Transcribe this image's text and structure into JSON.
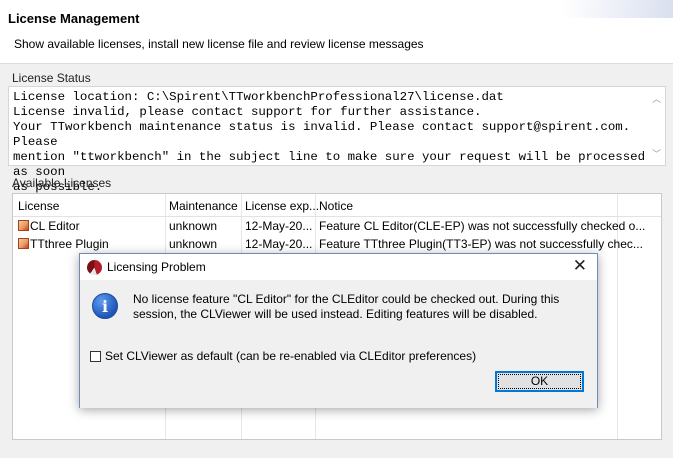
{
  "header": {
    "title": "License Management",
    "description": "Show available licenses, install new license file and review license messages"
  },
  "license_status": {
    "label": "License Status",
    "text": "License location: C:\\Spirent\\TTworkbenchProfessional27\\license.dat\nLicense invalid, please contact support for further assistance.\nYour TTworkbench maintenance status is invalid. Please contact support@spirent.com. Please\nmention \"ttworkbench\" in the subject line to make sure your request will be processed as soon\nas possible."
  },
  "available_licenses": {
    "label": "Available Licenses",
    "columns": [
      "License",
      "Maintenance",
      "License exp...",
      "Notice"
    ],
    "rows": [
      {
        "license": "CL Editor",
        "maintenance": "unknown",
        "expiry": "12-May-20...",
        "notice": "Feature CL Editor(CLE-EP) was not successfully checked o..."
      },
      {
        "license": "TTthree Plugin",
        "maintenance": "unknown",
        "expiry": "12-May-20...",
        "notice": "Feature TTthree Plugin(TT3-EP) was not successfully chec..."
      }
    ]
  },
  "dialog": {
    "title": "Licensing Problem",
    "close_glyph": "✕",
    "message": "No license feature \"CL Editor\" for the CLEditor could be checked out. During this session, the CLViewer will be used instead. Editing features will be disabled.",
    "checkbox_label": "Set CLViewer as default (can be re-enabled via CLEditor preferences)",
    "checkbox_checked": false,
    "ok_label": "OK",
    "icon": "info-icon"
  }
}
